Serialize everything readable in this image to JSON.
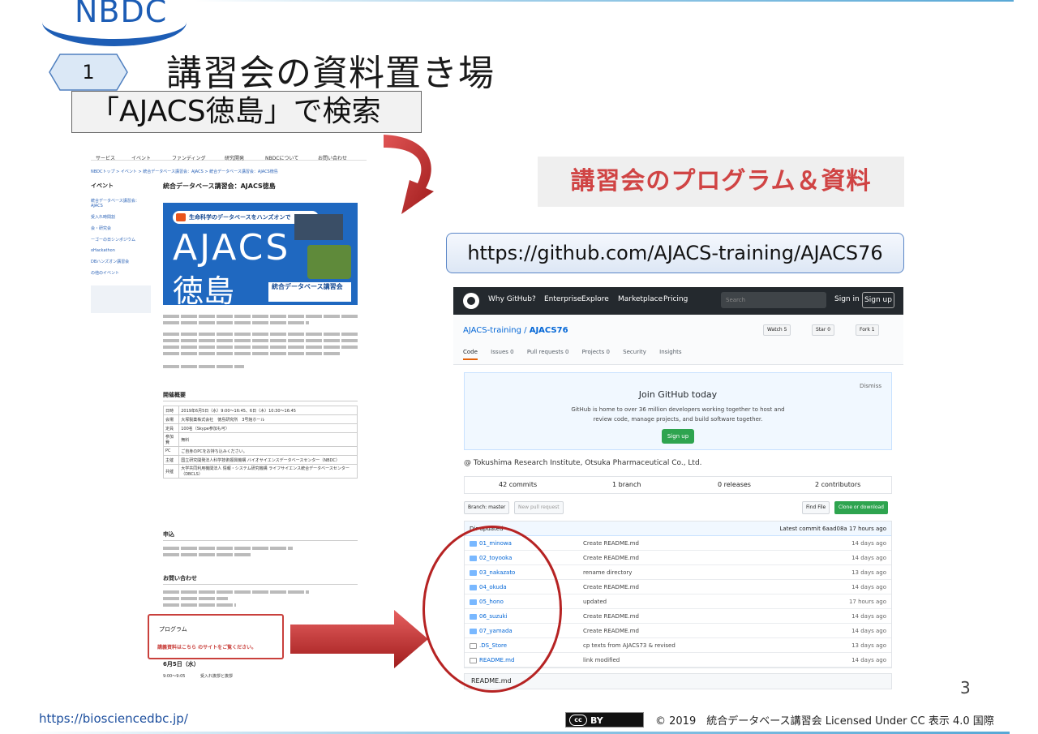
{
  "header": {
    "logo": "NBDC",
    "step_number": "1",
    "title": "講習会の資料置き場",
    "search_instruction": "「AJACS徳島」で検索"
  },
  "website": {
    "nav": [
      "サービス",
      "イベント",
      "ファンディング",
      "研究開発",
      "NBDCについて",
      "お問い合わせ"
    ],
    "breadcrumb": "NBDCトップ > イベント > 統合データベース講習会：AJACS > 統合データベース講習会：AJACS徳島",
    "sidebar_heading": "イベント",
    "sidebar_items": [
      "統合データベース講習会：AJACS",
      "受入れ時間割",
      "会・研究会",
      "ーゴーの日シンポジウム",
      "oHackathon",
      "DBハンズオン講習会",
      "の他のイベント"
    ],
    "page_heading": "統合データベース講習会：AJACS徳島",
    "banner_pill": "生命科学のデータベースをハンズオンで",
    "banner_title_1": "AJACS",
    "banner_title_2": "徳島",
    "banner_sub": "統合データベース講習会",
    "section_overview": "開催概要",
    "table_rows": [
      [
        "日時",
        "2019年6月5日（水）9:00〜16:45、6日（木）10:30〜16:45"
      ],
      [
        "会場",
        "大塚製薬株式会社　徳島研究所　3号館ホール"
      ],
      [
        "定員",
        "100名（Skype参加も可）"
      ],
      [
        "参加費",
        "無料"
      ],
      [
        "PC",
        "ご自身のPCをお持ち込みください。"
      ],
      [
        "主催",
        "国立研究開発法人科学技術振興機構 バイオサイエンスデータベースセンター（NBDC）"
      ],
      [
        "共催",
        "大学共同利用機関法人 情報・システム研究機構 ライフサイエンス統合データベースセンター（DBCLS）"
      ]
    ],
    "section_apply": "申込",
    "section_contact": "お問い合わせ",
    "program_heading": "プログラム",
    "program_link_text": "講義資料はこちら のサイトをご覧ください。",
    "schedule_day": "6月5日（水）",
    "schedule_time": "9:00〜9:05",
    "schedule_item": "受入れ挨拶と挨拶"
  },
  "right": {
    "program_banner": "講習会のプログラム＆資料",
    "url": "https://github.com/AJACS-training/AJACS76"
  },
  "github": {
    "nav": [
      "Why GitHub?",
      "Enterprise",
      "Explore",
      "Marketplace",
      "Pricing"
    ],
    "search_placeholder": "Search",
    "sign_in": "Sign in",
    "sign_up": "Sign up",
    "repo_owner": "AJACS-training",
    "repo_sep": " / ",
    "repo_name": "AJACS76",
    "watch": "Watch",
    "watch_count": "5",
    "star": "Star",
    "star_count": "0",
    "fork": "Fork",
    "fork_count": "1",
    "tabs": [
      "Code",
      "Issues 0",
      "Pull requests 0",
      "Projects 0",
      "Security",
      "Insights"
    ],
    "join_title": "Join GitHub today",
    "join_desc_1": "GitHub is home to over 36 million developers working together to host and",
    "join_desc_2": "review code, manage projects, and build software together.",
    "join_button": "Sign up",
    "dismiss": "Dismiss",
    "description": "@ Tokushima Research Institute, Otsuka Pharmaceutical Co., Ltd.",
    "commits": "42 commits",
    "branches": "1 branch",
    "releases": "0 releases",
    "contributors": "2 contributors",
    "branch_button": "Branch: master",
    "new_pr": "New pull request",
    "find_file": "Find File",
    "clone": "Clone or download",
    "latest_commit_left": "Dir updated",
    "latest_commit": "Latest commit 6aad08a 17 hours ago",
    "files": [
      {
        "name": "01_minowa",
        "msg": "Create README.md",
        "age": "14 days ago",
        "type": "dir"
      },
      {
        "name": "02_toyooka",
        "msg": "Create README.md",
        "age": "14 days ago",
        "type": "dir"
      },
      {
        "name": "03_nakazato",
        "msg": "rename directory",
        "age": "13 days ago",
        "type": "dir"
      },
      {
        "name": "04_okuda",
        "msg": "Create README.md",
        "age": "14 days ago",
        "type": "dir"
      },
      {
        "name": "05_hono",
        "msg": "updated",
        "age": "17 hours ago",
        "type": "dir"
      },
      {
        "name": "06_suzuki",
        "msg": "Create README.md",
        "age": "14 days ago",
        "type": "dir"
      },
      {
        "name": "07_yamada",
        "msg": "Create README.md",
        "age": "14 days ago",
        "type": "dir"
      },
      {
        "name": ".DS_Store",
        "msg": "cp texts from AJACS73 & revised",
        "age": "13 days ago",
        "type": "file"
      },
      {
        "name": "README.md",
        "msg": "link modified",
        "age": "14 days ago",
        "type": "file"
      }
    ],
    "readme_bar": "README.md"
  },
  "footer": {
    "page_number": "3",
    "url": "https://biosciencedbc.jp/",
    "cc_badge": "BY",
    "cc_symbol": "cc",
    "license": "© 2019　統合データベース講習会 Licensed Under CC 表示 4.0 国際"
  },
  "colors": {
    "nbdc_blue": "#1d5db5",
    "accent_red": "#c9403c",
    "github_dark": "#24292e",
    "github_green": "#2ea44f"
  }
}
